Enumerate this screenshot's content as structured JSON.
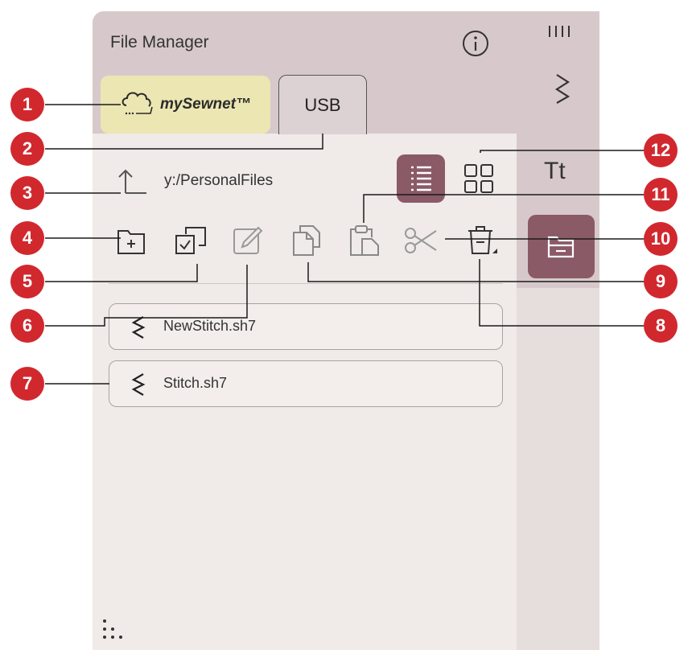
{
  "header": {
    "title": "File Manager"
  },
  "tabs": [
    {
      "id": "mysewnet",
      "label": "mySewnet™"
    },
    {
      "id": "usb",
      "label": "USB"
    }
  ],
  "path": "y:/PersonalFiles",
  "files": [
    {
      "name": "NewStitch.sh7",
      "icon": "stitch-icon"
    },
    {
      "name": "Stitch.sh7",
      "icon": "stitch-icon"
    }
  ],
  "right_column": {
    "text_icon": "Tt"
  },
  "callouts": [
    "1",
    "2",
    "3",
    "4",
    "5",
    "6",
    "7",
    "8",
    "9",
    "10",
    "11",
    "12"
  ],
  "colors": {
    "accent": "#8a5a66",
    "callout": "#d1282e",
    "mysewnet_tab": "#ece6b2"
  }
}
